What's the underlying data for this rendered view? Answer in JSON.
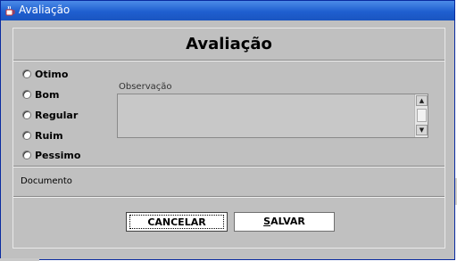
{
  "window": {
    "title": "Avaliação",
    "title_icon": "java-cup-icon"
  },
  "form": {
    "heading": "Avaliação",
    "rating_options": [
      "Otimo",
      "Bom",
      "Regular",
      "Ruim",
      "Pessimo"
    ],
    "selected_option": null,
    "observation_label": "Observação",
    "observation_value": "",
    "document_label": "Documento"
  },
  "buttons": {
    "cancel_label": "CANCELAR",
    "save_prefix": "S",
    "save_rest": "ALVAR"
  },
  "colors": {
    "titlebar": "#1f5fd0",
    "panel": "#c0c0c0"
  }
}
